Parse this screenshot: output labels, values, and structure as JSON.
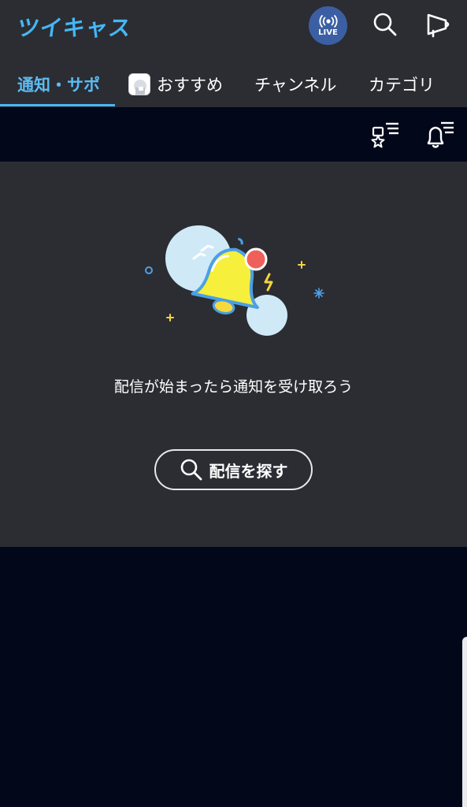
{
  "header": {
    "logo": "ツイキャス",
    "live_label": "LIVE",
    "icons": {
      "live": "live-broadcast-icon",
      "search": "search-icon",
      "broadcast": "megaphone-icon"
    }
  },
  "tabs": [
    {
      "label": "通知・サポ",
      "active": true
    },
    {
      "label": "おすすめ",
      "active": false,
      "icon": "avatar"
    },
    {
      "label": "チャンネル",
      "active": false
    },
    {
      "label": "カテゴリ",
      "active": false
    }
  ],
  "toolbar": {
    "icons": [
      "favorite-filter-icon",
      "notification-filter-icon"
    ]
  },
  "empty_state": {
    "message": "配信が始まったら通知を受け取ろう",
    "button_label": "配信を探す",
    "illustration": "bell-illustration"
  },
  "colors": {
    "accent": "#45b7f5",
    "header_bg": "#2b2d33",
    "page_bg": "#03071a",
    "live_bg": "#3c5fa3",
    "bell_yellow": "#f6ef3b",
    "badge_red": "#f0605a"
  }
}
